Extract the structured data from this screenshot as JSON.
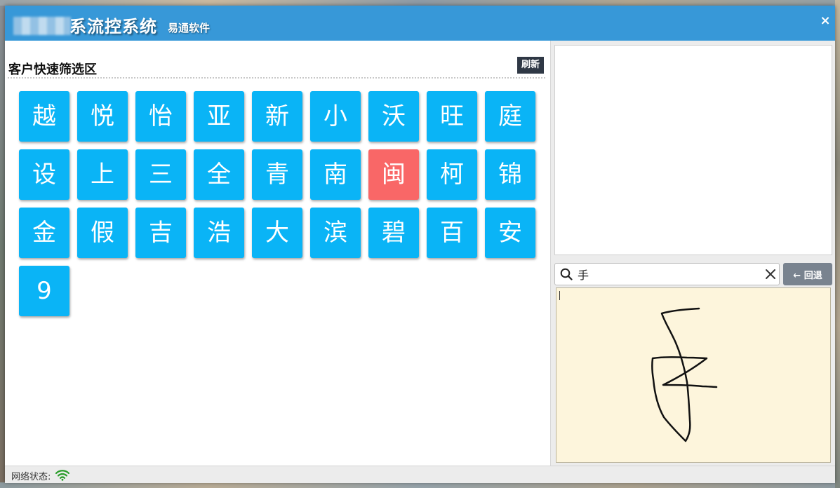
{
  "window": {
    "title": "系流控系统",
    "subtitle": "易通软件",
    "close_label": "×"
  },
  "filter": {
    "section_title": "客户快速筛选区",
    "refresh_label": "刷新",
    "active_key": "闽",
    "keys": [
      "越",
      "悦",
      "怡",
      "亚",
      "新",
      "小",
      "沃",
      "旺",
      "庭",
      "设",
      "上",
      "三",
      "全",
      "青",
      "南",
      "闽",
      "柯",
      "锦",
      "金",
      "假",
      "吉",
      "浩",
      "大",
      "滨",
      "碧",
      "百",
      "安",
      "9"
    ]
  },
  "search": {
    "value": "手",
    "placeholder": "",
    "clear_icon": "close-icon",
    "search_icon": "search-icon"
  },
  "back_button": {
    "label": "回退",
    "icon": "arrow-left-icon"
  },
  "handwriting": {
    "recognized": "手"
  },
  "status": {
    "label": "网络状态:",
    "icon": "wifi-icon",
    "color": "#2a9d2a"
  },
  "colors": {
    "titlebar": "#3798d8",
    "key": "#0ab4f6",
    "key_active": "#f96767",
    "refresh": "#2f3845",
    "back": "#79838f",
    "pad": "#fdf5dc"
  }
}
